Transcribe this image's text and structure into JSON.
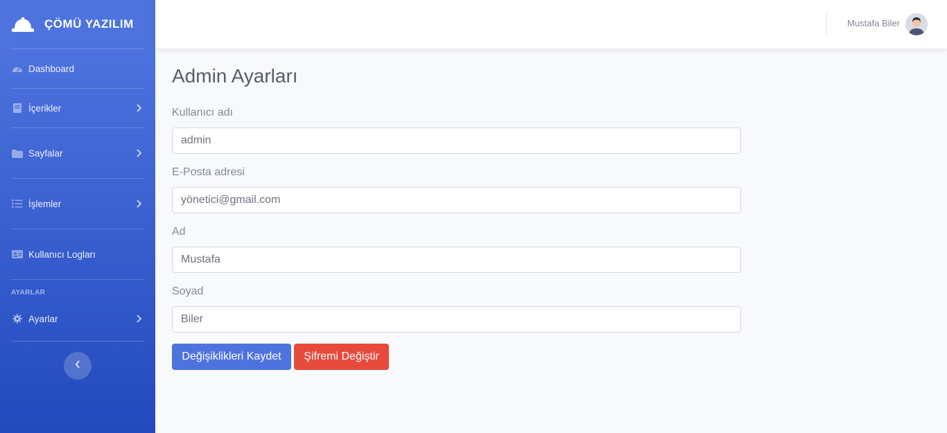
{
  "brand": {
    "name": "ÇÖMÜ YAZILIM"
  },
  "sidebar": {
    "items": [
      {
        "label": "Dashboard",
        "icon": "gauge-icon"
      },
      {
        "label": "İçerikler",
        "icon": "book-icon"
      },
      {
        "label": "Sayfalar",
        "icon": "folder-icon"
      },
      {
        "label": "İşlemler",
        "icon": "list-icon"
      },
      {
        "label": "Kullanıcı Logları",
        "icon": "id-card-icon"
      }
    ],
    "heading": "AYARLAR",
    "settings": {
      "label": "Ayarlar",
      "icon": "gear-icon"
    }
  },
  "topbar": {
    "user_name": "Mustafa Biler"
  },
  "page": {
    "title": "Admin Ayarları"
  },
  "form": {
    "username": {
      "label": "Kullanıcı adı",
      "value": "admin"
    },
    "email": {
      "label": "E-Posta adresi",
      "value": "yönetici@gmail.com"
    },
    "first_name": {
      "label": "Ad",
      "value": "Mustafa"
    },
    "last_name": {
      "label": "Soyad",
      "value": "Biler"
    },
    "save_label": "Değişiklikleri Kaydet",
    "change_password_label": "Şifremi Değiştir"
  },
  "colors": {
    "primary": "#4e73df",
    "danger": "#e74a3b",
    "sidebar_top": "#4e73df",
    "sidebar_bottom": "#224abe"
  }
}
